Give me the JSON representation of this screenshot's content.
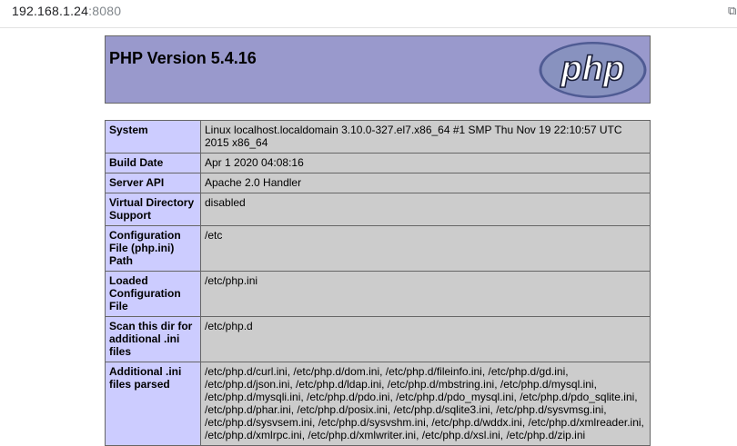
{
  "browser": {
    "url_host": "192.168.1.24",
    "url_port": ":8080"
  },
  "header": {
    "title": "PHP Version 5.4.16",
    "logo_text": "php",
    "colors": {
      "header_bg": "#9999cc",
      "label_bg": "#ccccff",
      "value_bg": "#cccccc",
      "logo_fill": "#8892bf",
      "logo_dark": "#4f5b93"
    }
  },
  "rows": [
    {
      "label": "System",
      "value": "Linux localhost.localdomain 3.10.0-327.el7.x86_64 #1 SMP Thu Nov 19 22:10:57 UTC 2015 x86_64"
    },
    {
      "label": "Build Date",
      "value": "Apr 1 2020 04:08:16"
    },
    {
      "label": "Server API",
      "value": "Apache 2.0 Handler"
    },
    {
      "label": "Virtual Directory Support",
      "value": "disabled"
    },
    {
      "label": "Configuration File (php.ini) Path",
      "value": "/etc"
    },
    {
      "label": "Loaded Configuration File",
      "value": "/etc/php.ini"
    },
    {
      "label": "Scan this dir for additional .ini files",
      "value": "/etc/php.d"
    },
    {
      "label": "Additional .ini files parsed",
      "value": "/etc/php.d/curl.ini, /etc/php.d/dom.ini, /etc/php.d/fileinfo.ini, /etc/php.d/gd.ini, /etc/php.d/json.ini, /etc/php.d/ldap.ini, /etc/php.d/mbstring.ini, /etc/php.d/mysql.ini, /etc/php.d/mysqli.ini, /etc/php.d/pdo.ini, /etc/php.d/pdo_mysql.ini, /etc/php.d/pdo_sqlite.ini, /etc/php.d/phar.ini, /etc/php.d/posix.ini, /etc/php.d/sqlite3.ini, /etc/php.d/sysvmsg.ini, /etc/php.d/sysvsem.ini, /etc/php.d/sysvshm.ini, /etc/php.d/wddx.ini, /etc/php.d/xmlreader.ini, /etc/php.d/xmlrpc.ini, /etc/php.d/xmlwriter.ini, /etc/php.d/xsl.ini, /etc/php.d/zip.ini"
    }
  ]
}
